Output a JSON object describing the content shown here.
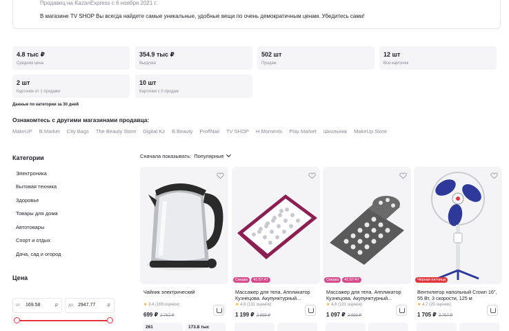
{
  "seller": {
    "since": "Продавец на KazanExpress с 6 ноября 2021 г.",
    "description": "В магазине TV SHOP Вы всегда найдете самые уникальные, удобные вещи по очень демократичным ценам. Убедитесь сами!"
  },
  "stats": [
    {
      "value": "4.8 тыс ₽",
      "label": "Средняя цена"
    },
    {
      "value": "354.9 тыс ₽",
      "label": "Выручка"
    },
    {
      "value": "502 шт",
      "label": "Продаж"
    },
    {
      "value": "12 шт",
      "label": "Все карточек"
    },
    {
      "value": "2 шт",
      "label": "Карточек от 1 продажи"
    },
    {
      "value": "10 шт",
      "label": "Карточки с 0 продаж"
    }
  ],
  "period_note": "Данные по категории за 30 дней",
  "other_shops": {
    "title": "Ознакомтесь с другими магазинами продавца:",
    "items": [
      "MakeUP",
      "B.Market",
      "City Bags",
      "The Beauty Store",
      "Digital Kz",
      "B.Beauty",
      "ProffNail",
      "TV SHOP",
      "H.Moments",
      "Play Market",
      "Школьник",
      "MakeUp Store"
    ]
  },
  "categories": {
    "title": "Категории",
    "items": [
      "Электроника",
      "Бытовая техника",
      "Здоровье",
      "Товары для дома",
      "Автотовары",
      "Спорт и отдых",
      "Дача, сад и огород"
    ]
  },
  "price_filter": {
    "title": "Цена",
    "from_prefix": "от",
    "from_value": "169.58",
    "to_prefix": "до",
    "to_value": "2947.77",
    "currency": "₽"
  },
  "sort": {
    "label": "Сначала показывать:",
    "value": "Популярные"
  },
  "products": [
    {
      "title": "Чайник электрический",
      "rating": "3.4",
      "reviews": "(169 оценок)",
      "price": "699 ₽",
      "old_price": "2 767 ₽",
      "badges": [],
      "mini1": "261",
      "mini2": "173.8 тыс"
    },
    {
      "title": "Массажер для тела. Аппликатор Кузнецова. Акупунктурный...",
      "rating": "4.8",
      "reviews": "(131 оценок)",
      "price": "1 199 ₽",
      "old_price": "2 999 ₽",
      "badges": [
        "Скидка",
        "41:57:47"
      ],
      "mini1": "",
      "mini2": ""
    },
    {
      "title": "Массажер для тела. Аппликатор Кузнецова. Акупунктурный...",
      "rating": "4.8",
      "reviews": "(131 оценок)",
      "price": "1 097 ₽",
      "old_price": "2 999 ₽",
      "badges": [
        "Скидка",
        "41:57:47"
      ],
      "mini1": "",
      "mini2": ""
    },
    {
      "title": "Вентилятор напольный Crown 16\", 55 Вт, 3 скорости, 125 м",
      "rating": "4.7",
      "reviews": "(25 оценок)",
      "price": "1 705 ₽",
      "old_price": "3 767 ₽",
      "badges": [
        "Чёрная пятница"
      ],
      "mini1": "",
      "mini2": ""
    }
  ],
  "colors": {
    "accent": "#e3343a",
    "badge_pink": "#d64a8c",
    "star": "#f1a500"
  }
}
